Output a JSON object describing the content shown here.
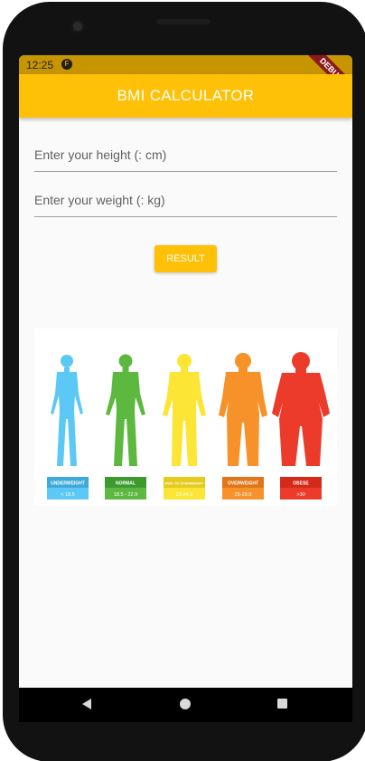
{
  "status_bar": {
    "time": "12:25",
    "app_icon": "flutter-icon",
    "debug_banner": "DEBUG"
  },
  "app_bar": {
    "title": "BMI CALCULATOR",
    "color": "#FFC107"
  },
  "form": {
    "height_placeholder": "Enter your height (: cm)",
    "weight_placeholder": "Enter your weight (: kg)",
    "result_label": "RESULT"
  },
  "bmi_chart": {
    "categories": [
      {
        "label": "UNDERWEIGHT",
        "range": "< 18.5",
        "color": "#5BC8F5",
        "band": "#3FA9DC"
      },
      {
        "label": "NORMAL",
        "range": "18.5 - 22.9",
        "color": "#5DB83F",
        "band": "#3E9A2F"
      },
      {
        "label": "RISK TO OVERWEIGHT",
        "range": "23-24.9",
        "color": "#FCE535",
        "band": "#E5CB1E"
      },
      {
        "label": "OVERWEIGHT",
        "range": "25-29.9",
        "color": "#F7922A",
        "band": "#E0761A"
      },
      {
        "label": "OBESE",
        "range": ">30",
        "color": "#EC3B2A",
        "band": "#D42A1C"
      }
    ]
  },
  "nav_bar": {
    "icons": [
      "back-icon",
      "home-icon",
      "recent-apps-icon"
    ]
  }
}
